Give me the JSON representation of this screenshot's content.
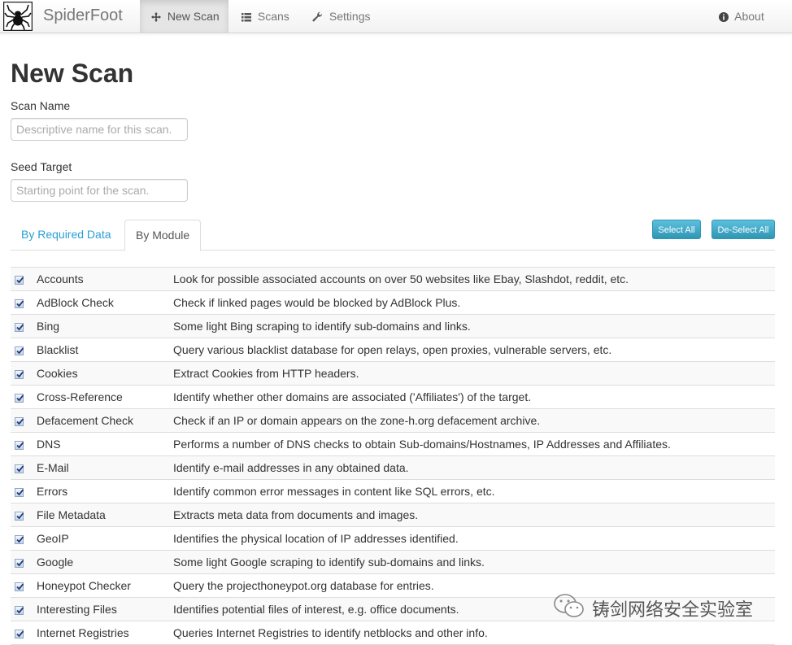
{
  "navbar": {
    "brand": "SpiderFoot",
    "items": [
      {
        "label": "New Scan",
        "icon": "move-icon"
      },
      {
        "label": "Scans",
        "icon": "list-icon"
      },
      {
        "label": "Settings",
        "icon": "wrench-icon"
      }
    ],
    "about": {
      "label": "About",
      "icon": "info-icon"
    }
  },
  "page": {
    "title": "New Scan",
    "scan_name": {
      "label": "Scan Name",
      "placeholder": "Descriptive name for this scan."
    },
    "seed_target": {
      "label": "Seed Target",
      "placeholder": "Starting point for the scan."
    }
  },
  "tabs": [
    "By Required Data",
    "By Module"
  ],
  "buttons": {
    "select_all": "Select All",
    "deselect_all": "De-Select All"
  },
  "modules": [
    {
      "name": "Accounts",
      "description": "Look for possible associated accounts on over 50 websites like Ebay, Slashdot, reddit, etc.",
      "checked": true
    },
    {
      "name": "AdBlock Check",
      "description": "Check if linked pages would be blocked by AdBlock Plus.",
      "checked": true
    },
    {
      "name": "Bing",
      "description": "Some light Bing scraping to identify sub-domains and links.",
      "checked": true
    },
    {
      "name": "Blacklist",
      "description": "Query various blacklist database for open relays, open proxies, vulnerable servers, etc.",
      "checked": true
    },
    {
      "name": "Cookies",
      "description": "Extract Cookies from HTTP headers.",
      "checked": true
    },
    {
      "name": "Cross-Reference",
      "description": "Identify whether other domains are associated ('Affiliates') of the target.",
      "checked": true
    },
    {
      "name": "Defacement Check",
      "description": "Check if an IP or domain appears on the zone-h.org defacement archive.",
      "checked": true
    },
    {
      "name": "DNS",
      "description": "Performs a number of DNS checks to obtain Sub-domains/Hostnames, IP Addresses and Affiliates.",
      "checked": true
    },
    {
      "name": "E-Mail",
      "description": "Identify e-mail addresses in any obtained data.",
      "checked": true
    },
    {
      "name": "Errors",
      "description": "Identify common error messages in content like SQL errors, etc.",
      "checked": true
    },
    {
      "name": "File Metadata",
      "description": "Extracts meta data from documents and images.",
      "checked": true
    },
    {
      "name": "GeoIP",
      "description": "Identifies the physical location of IP addresses identified.",
      "checked": true
    },
    {
      "name": "Google",
      "description": "Some light Google scraping to identify sub-domains and links.",
      "checked": true
    },
    {
      "name": "Honeypot Checker",
      "description": "Query the projecthoneypot.org database for entries.",
      "checked": true
    },
    {
      "name": "Interesting Files",
      "description": "Identifies potential files of interest, e.g. office documents.",
      "checked": true
    },
    {
      "name": "Internet Registries",
      "description": "Queries Internet Registries to identify netblocks and other info.",
      "checked": true
    }
  ],
  "watermark": "铸剑网络安全实验室",
  "colors": {
    "link": "#2a9fd6",
    "button": "#5bc0de"
  }
}
